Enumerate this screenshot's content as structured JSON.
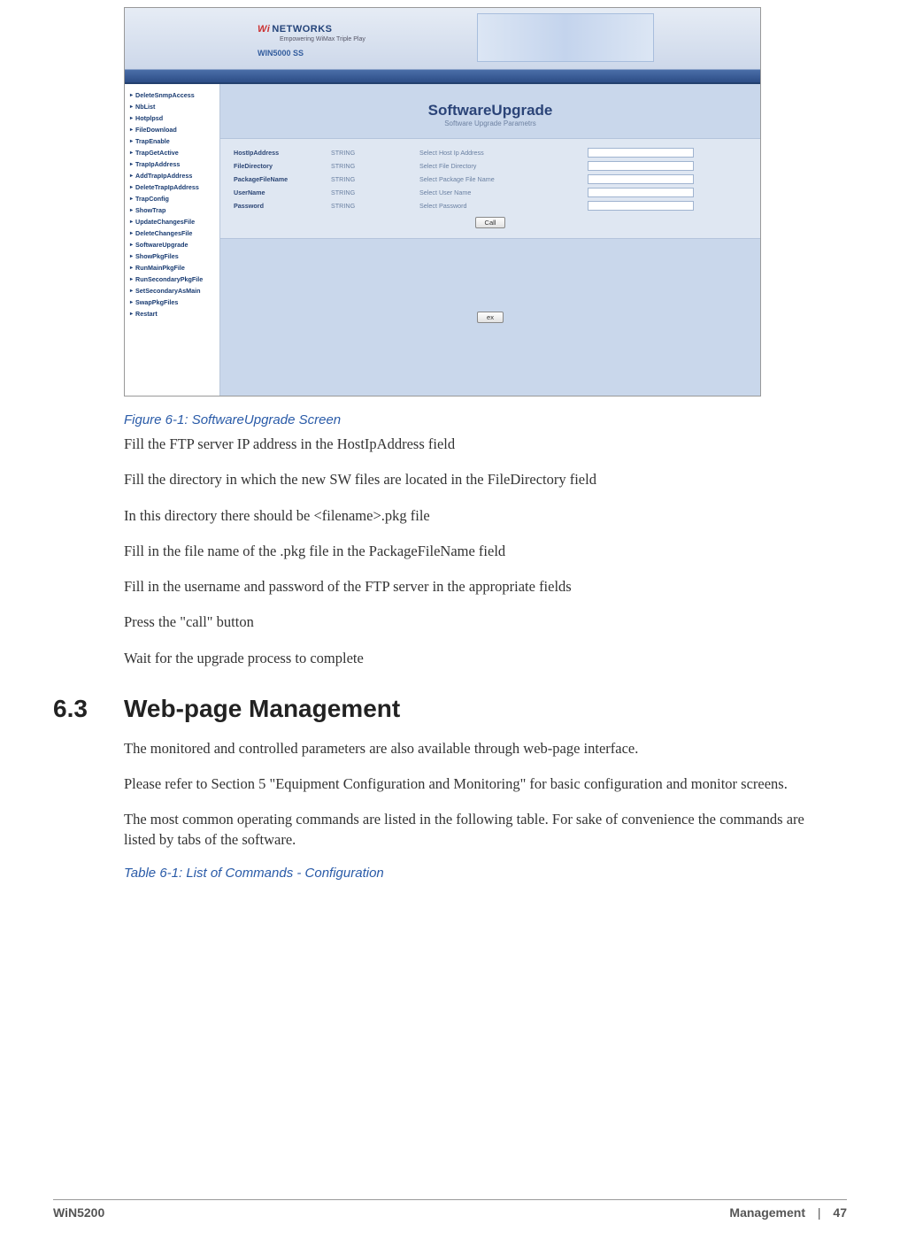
{
  "screenshot": {
    "logo_text": "NETWORKS",
    "tagline": "Empowering WiMax Triple Play",
    "device_label": "WIN5000 SS",
    "hero_placeholder": "",
    "panel": {
      "title": "SoftwareUpgrade",
      "subtitle": "Software Upgrade Parametrs"
    },
    "sidebar_items": [
      "DeleteSnmpAccess",
      "NbList",
      "Hotplpsd",
      "FileDownload",
      "TrapEnable",
      "TrapGetActive",
      "TrapIpAddress",
      "AddTrapIpAddress",
      "DeleteTrapIpAddress",
      "TrapConfig",
      "ShowTrap",
      "UpdateChangesFile",
      "DeleteChangesFile",
      "SoftwareUpgrade",
      "ShowPkgFiles",
      "RunMainPkgFile",
      "RunSecondaryPkgFile",
      "SetSecondaryAsMain",
      "SwapPkgFiles",
      "Restart"
    ],
    "form_rows": [
      {
        "name": "HostIpAddress",
        "type": "STRING",
        "help": "Select Host Ip Address"
      },
      {
        "name": "FileDirectory",
        "type": "STRING",
        "help": "Select File Directory"
      },
      {
        "name": "PackageFileName",
        "type": "STRING",
        "help": "Select Package File Name"
      },
      {
        "name": "UserName",
        "type": "STRING",
        "help": "Select User Name"
      },
      {
        "name": "Password",
        "type": "STRING",
        "help": "Select Password"
      }
    ],
    "call_button": "Call",
    "ex_button": "ex"
  },
  "captions": {
    "figure": "Figure 6-1: SoftwareUpgrade Screen",
    "table": "Table 6-1: List of Commands - Configuration"
  },
  "body": {
    "p1": "Fill the FTP server IP address in the HostIpAddress field",
    "p2": "Fill the directory in which the new SW files are located in the FileDirectory field",
    "p3": "In this directory there should be <filename>.pkg file",
    "p4": "Fill in the file name of the .pkg file in the PackageFileName field",
    "p5": "Fill in the username and password of the FTP server in the appropriate fields",
    "p6": "Press the \"call\" button",
    "p7": "Wait for the upgrade process to complete"
  },
  "section": {
    "number": "6.3",
    "title": "Web-page Management",
    "p1": "The monitored and controlled parameters are also available through web-page interface.",
    "p2": "Please refer to Section 5 \"Equipment Configuration and Monitoring\" for basic configuration and monitor screens.",
    "p3": "The most common operating commands are listed in the following table. For sake of convenience the commands are listed by tabs of the software."
  },
  "footer": {
    "left": "WiN5200",
    "right_label": "Management",
    "separator": "|",
    "page": "47"
  }
}
